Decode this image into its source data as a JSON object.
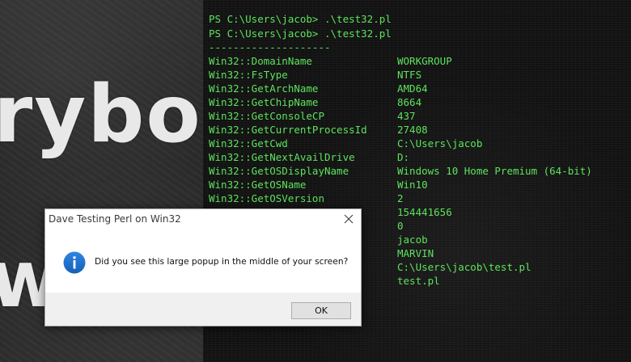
{
  "wallpaper": {
    "word_top": "rybo",
    "word_bottom": "w"
  },
  "terminal": {
    "prompts": [
      "PS C:\\Users\\jacob> .\\test32.pl",
      "PS C:\\Users\\jacob> .\\test32.pl"
    ],
    "separator": "--------------------",
    "rows": [
      {
        "key": "Win32::DomainName",
        "value": "WORKGROUP"
      },
      {
        "key": "Win32::FsType",
        "value": "NTFS"
      },
      {
        "key": "Win32::GetArchName",
        "value": "AMD64"
      },
      {
        "key": "Win32::GetChipName",
        "value": "8664"
      },
      {
        "key": "Win32::GetConsoleCP",
        "value": "437"
      },
      {
        "key": "Win32::GetCurrentProcessId",
        "value": "27408"
      },
      {
        "key": "Win32::GetCwd",
        "value": "C:\\Users\\jacob"
      },
      {
        "key": "Win32::GetNextAvailDrive",
        "value": "D:"
      },
      {
        "key": "Win32::GetOSDisplayName",
        "value": "Windows 10 Home Premium (64-bit)"
      },
      {
        "key": "Win32::GetOSName",
        "value": "Win10"
      },
      {
        "key": "Win32::GetOSVersion",
        "value": "2"
      },
      {
        "key": "",
        "value": "154441656"
      },
      {
        "key": "",
        "value": "0"
      },
      {
        "key": "",
        "value": "jacob"
      },
      {
        "key": "",
        "value": "MARVIN"
      },
      {
        "key": "",
        "value": "C:\\Users\\jacob\\test.pl"
      },
      {
        "key": "",
        "value": "test.pl"
      }
    ]
  },
  "dialog": {
    "title": "Dave Testing Perl on Win32",
    "icon": "info-icon",
    "message": "Did you see this large popup in the middle of your screen?",
    "ok_label": "OK"
  },
  "colors": {
    "terminal_text": "#5de35d",
    "terminal_bg": "#121212",
    "info_blue": "#1a6fd0"
  }
}
